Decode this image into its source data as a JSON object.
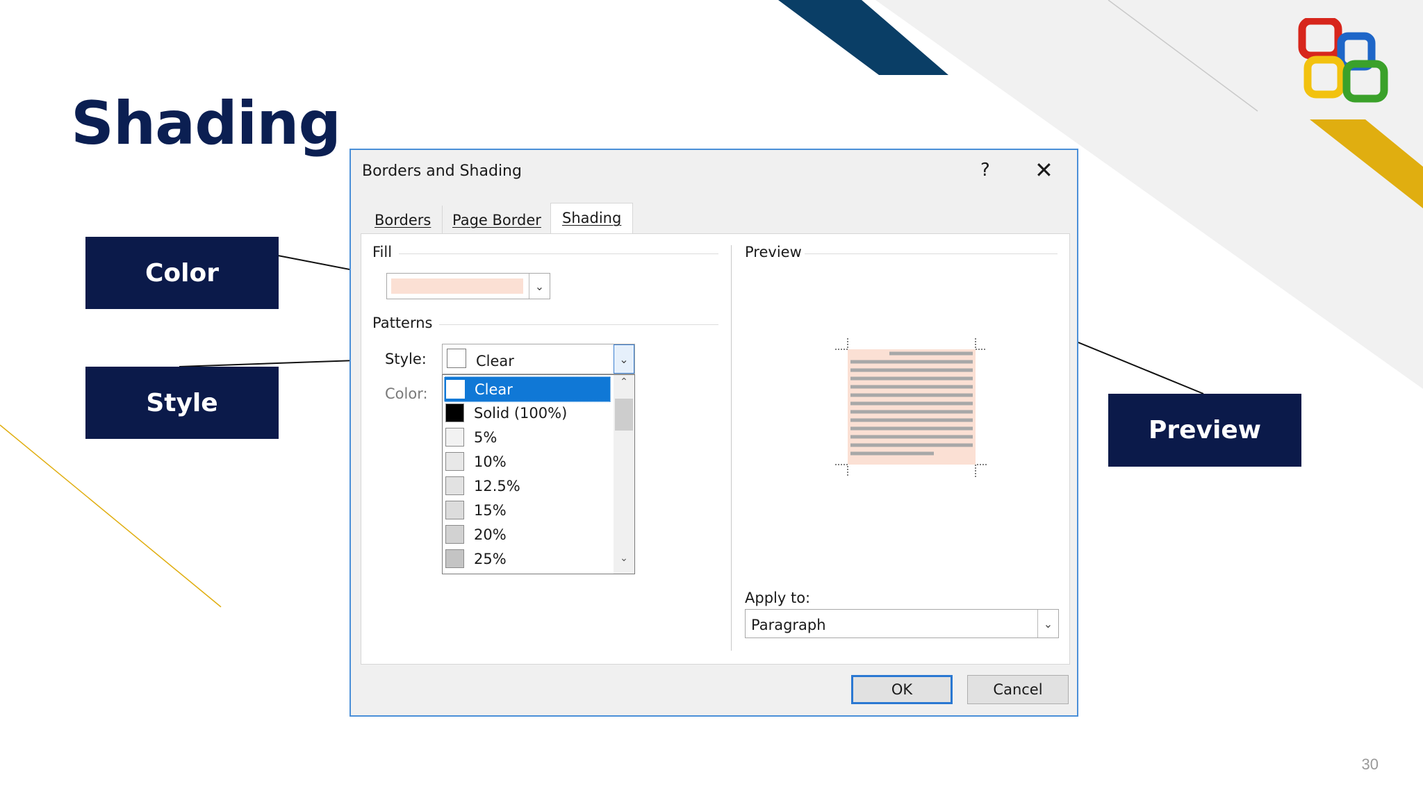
{
  "slide": {
    "title": "Shading",
    "page_number": "30",
    "callouts": {
      "color": "Color",
      "style": "Style",
      "preview": "Preview"
    },
    "colors": {
      "title": "#0b1f52",
      "callout_bg": "#0b1a4a",
      "accent_gold": "#e0ae10",
      "accent_navy": "#0a3e66"
    }
  },
  "logo": {
    "icon": "office-logo-icon"
  },
  "dialog": {
    "title": "Borders and Shading",
    "help": "?",
    "close": "✕",
    "tabs": [
      {
        "label": "Borders",
        "active": false
      },
      {
        "label": "Page Border",
        "active": false
      },
      {
        "label": "Shading",
        "active": true
      }
    ],
    "fill": {
      "label": "Fill",
      "color": "#fbe0d4"
    },
    "patterns": {
      "label": "Patterns",
      "style_label": "Style:",
      "color_label": "Color:",
      "style_value": "Clear",
      "options": [
        {
          "label": "Clear",
          "swatch": "#ffffff",
          "selected": true
        },
        {
          "label": "Solid (100%)",
          "swatch": "#000000",
          "selected": false
        },
        {
          "label": "5%",
          "swatch": "#f2f2f2",
          "selected": false
        },
        {
          "label": "10%",
          "swatch": "#e8e8e8",
          "selected": false
        },
        {
          "label": "12.5%",
          "swatch": "#e2e2e2",
          "selected": false
        },
        {
          "label": "15%",
          "swatch": "#dcdcdc",
          "selected": false
        },
        {
          "label": "20%",
          "swatch": "#d2d2d2",
          "selected": false
        },
        {
          "label": "25%",
          "swatch": "#c4c4c4",
          "selected": false
        }
      ]
    },
    "preview": {
      "label": "Preview",
      "fill_color": "#fbe0d4"
    },
    "apply_to": {
      "label": "Apply to:",
      "value": "Paragraph"
    },
    "buttons": {
      "ok": "OK",
      "cancel": "Cancel"
    }
  }
}
